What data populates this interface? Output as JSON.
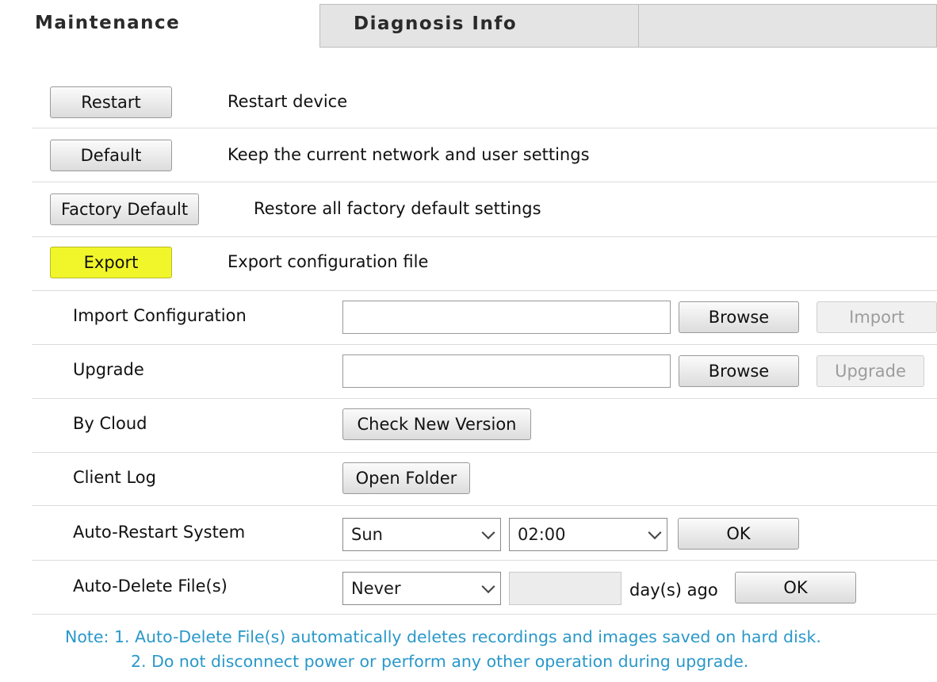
{
  "tabs": {
    "maintenance": "Maintenance",
    "diagnosis": "Diagnosis Info"
  },
  "actions": [
    {
      "button": "Restart",
      "description": "Restart device"
    },
    {
      "button": "Default",
      "description": "Keep the current network and user settings"
    },
    {
      "button": "Factory Default",
      "description": "Restore all factory default settings"
    },
    {
      "button": "Export",
      "description": "Export configuration file"
    }
  ],
  "import_config": {
    "label": "Import Configuration",
    "value": "",
    "browse": "Browse",
    "action": "Import"
  },
  "upgrade": {
    "label": "Upgrade",
    "value": "",
    "browse": "Browse",
    "action": "Upgrade"
  },
  "cloud": {
    "label": "By Cloud",
    "button": "Check New Version"
  },
  "client_log": {
    "label": "Client Log",
    "button": "Open Folder"
  },
  "auto_restart": {
    "label": "Auto-Restart System",
    "day": "Sun",
    "time": "02:00",
    "ok": "OK"
  },
  "auto_delete": {
    "label": "Auto-Delete File(s)",
    "mode": "Never",
    "days": "",
    "suffix": "day(s) ago",
    "ok": "OK"
  },
  "notes": {
    "line1": "Note: 1. Auto-Delete File(s) automatically deletes recordings and images saved on hard disk.",
    "line2": "2. Do not disconnect power or perform any other operation during upgrade."
  },
  "colors": {
    "highlight": "#f1f62a",
    "note": "#2a98c9"
  }
}
